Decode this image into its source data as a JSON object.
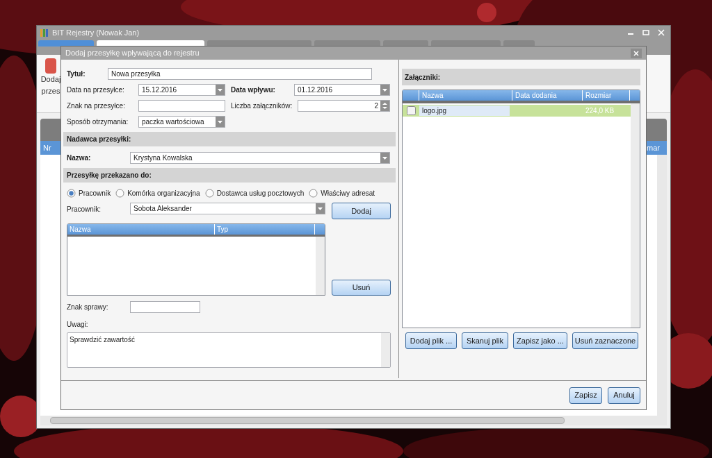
{
  "main_window": {
    "title": "BIT Rejestry (Nowak Jan)",
    "tabs": [
      {
        "selected": false,
        "kind": "app"
      },
      {
        "selected": true,
        "kind": "tab"
      },
      {
        "selected": false,
        "kind": "tab"
      },
      {
        "selected": false,
        "kind": "tab"
      },
      {
        "selected": false,
        "kind": "tab"
      },
      {
        "selected": false,
        "kind": "tab"
      },
      {
        "selected": false,
        "kind": "tab"
      }
    ],
    "toolbar_button": {
      "label_lines": [
        "Dodaj",
        "przes"
      ]
    },
    "table": {
      "columns": [
        "Nr",
        "mar"
      ]
    }
  },
  "dialog": {
    "title": "Dodaj przesyłkę wpływającą do rejestru",
    "title_field": {
      "label": "Tytuł:",
      "value": "Nowa przesyłka"
    },
    "date_on_parcel": {
      "label": "Data na przesyłce:",
      "value": "15.12.2016"
    },
    "date_received": {
      "label": "Data wpływu:",
      "value": "01.12.2016"
    },
    "parcel_mark": {
      "label": "Znak na przesyłce:"
    },
    "attachment_count": {
      "label": "Liczba załączników:",
      "value": "2"
    },
    "delivery_method": {
      "label": "Sposób otrzymania:",
      "value": "paczka wartościowa"
    },
    "sender_section": {
      "heading": "Nadawca przesyłki:",
      "name_label": "Nazwa:",
      "name_value": "Krystyna Kowalska"
    },
    "forward_section": {
      "heading": "Przesyłkę przekazano do:",
      "options": [
        {
          "label": "Pracownik",
          "selected": true
        },
        {
          "label": "Komórka organizacyjna",
          "selected": false
        },
        {
          "label": "Dostawca usług pocztowych",
          "selected": false
        },
        {
          "label": "Właściwy adresat",
          "selected": false
        }
      ],
      "employee_label": "Pracownik:",
      "employee_value": "Sobota Aleksander",
      "add_button": "Dodaj",
      "table": {
        "columns": [
          "Nazwa",
          "Typ"
        ]
      },
      "remove_button": "Usuń"
    },
    "case_mark": {
      "label": "Znak sprawy:"
    },
    "notes": {
      "label": "Uwagi:",
      "value": "Sprawdzić zawartość"
    },
    "attachments": {
      "heading": "Załączniki:",
      "columns": [
        "Nazwa",
        "Data dodania",
        "Rozmiar"
      ],
      "rows": [
        {
          "checked": false,
          "name": "logo.jpg",
          "size": "224,0 KB"
        }
      ],
      "buttons": [
        "Dodaj plik ...",
        "Skanuj plik",
        "Zapisz jako ...",
        "Usuń zaznaczone"
      ]
    },
    "footer_buttons": [
      "Zapisz",
      "Anuluj"
    ]
  }
}
